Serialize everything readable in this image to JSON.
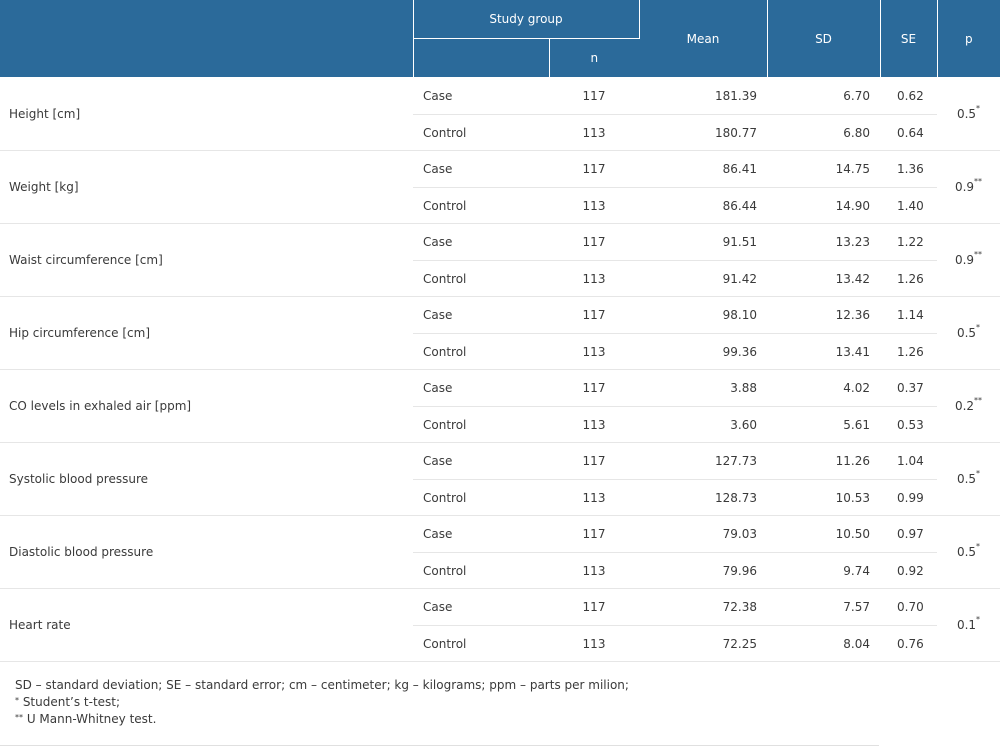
{
  "header": {
    "study_group": "Study group",
    "n": "n",
    "mean": "Mean",
    "sd": "SD",
    "se": "SE",
    "p": "p"
  },
  "rows": [
    {
      "variable": "Height [cm]",
      "groups": [
        {
          "group": "Case",
          "n": "117",
          "mean": "181.39",
          "sd": "6.70",
          "se": "0.62"
        },
        {
          "group": "Control",
          "n": "113",
          "mean": "180.77",
          "sd": "6.80",
          "se": "0.64"
        }
      ],
      "p": "0.5",
      "p_mark": "*"
    },
    {
      "variable": "Weight [kg]",
      "groups": [
        {
          "group": "Case",
          "n": "117",
          "mean": "86.41",
          "sd": "14.75",
          "se": "1.36"
        },
        {
          "group": "Control",
          "n": "113",
          "mean": "86.44",
          "sd": "14.90",
          "se": "1.40"
        }
      ],
      "p": "0.9",
      "p_mark": "**"
    },
    {
      "variable": "Waist circumference [cm]",
      "groups": [
        {
          "group": "Case",
          "n": "117",
          "mean": "91.51",
          "sd": "13.23",
          "se": "1.22"
        },
        {
          "group": "Control",
          "n": "113",
          "mean": "91.42",
          "sd": "13.42",
          "se": "1.26"
        }
      ],
      "p": "0.9",
      "p_mark": "**"
    },
    {
      "variable": "Hip circumference [cm]",
      "groups": [
        {
          "group": "Case",
          "n": "117",
          "mean": "98.10",
          "sd": "12.36",
          "se": "1.14"
        },
        {
          "group": "Control",
          "n": "113",
          "mean": "99.36",
          "sd": "13.41",
          "se": "1.26"
        }
      ],
      "p": "0.5",
      "p_mark": "*"
    },
    {
      "variable": "CO levels in exhaled air [ppm]",
      "groups": [
        {
          "group": "Case",
          "n": "117",
          "mean": "3.88",
          "sd": "4.02",
          "se": "0.37"
        },
        {
          "group": "Control",
          "n": "113",
          "mean": "3.60",
          "sd": "5.61",
          "se": "0.53"
        }
      ],
      "p": "0.2",
      "p_mark": "**"
    },
    {
      "variable": "Systolic blood pressure",
      "groups": [
        {
          "group": "Case",
          "n": "117",
          "mean": "127.73",
          "sd": "11.26",
          "se": "1.04"
        },
        {
          "group": "Control",
          "n": "113",
          "mean": "128.73",
          "sd": "10.53",
          "se": "0.99"
        }
      ],
      "p": "0.5",
      "p_mark": "*"
    },
    {
      "variable": "Diastolic blood pressure",
      "groups": [
        {
          "group": "Case",
          "n": "117",
          "mean": "79.03",
          "sd": "10.50",
          "se": "0.97"
        },
        {
          "group": "Control",
          "n": "113",
          "mean": "79.96",
          "sd": "9.74",
          "se": "0.92"
        }
      ],
      "p": "0.5",
      "p_mark": "*"
    },
    {
      "variable": "Heart rate",
      "groups": [
        {
          "group": "Case",
          "n": "117",
          "mean": "72.38",
          "sd": "7.57",
          "se": "0.70"
        },
        {
          "group": "Control",
          "n": "113",
          "mean": "72.25",
          "sd": "8.04",
          "se": "0.76"
        }
      ],
      "p": "0.1",
      "p_mark": "*"
    }
  ],
  "footnotes": {
    "abbreviations": "SD – standard deviation; SE – standard error; cm – centimeter; kg – kilograms; ppm – parts per milion;",
    "mark1": "*",
    "note1": " Student’s t-test;",
    "mark2": "**",
    "note2": " U Mann-Whitney test."
  },
  "colors": {
    "header_bg": "#2b6a9a",
    "header_text": "#ffffff",
    "row_divider": "#e6e6e6"
  }
}
